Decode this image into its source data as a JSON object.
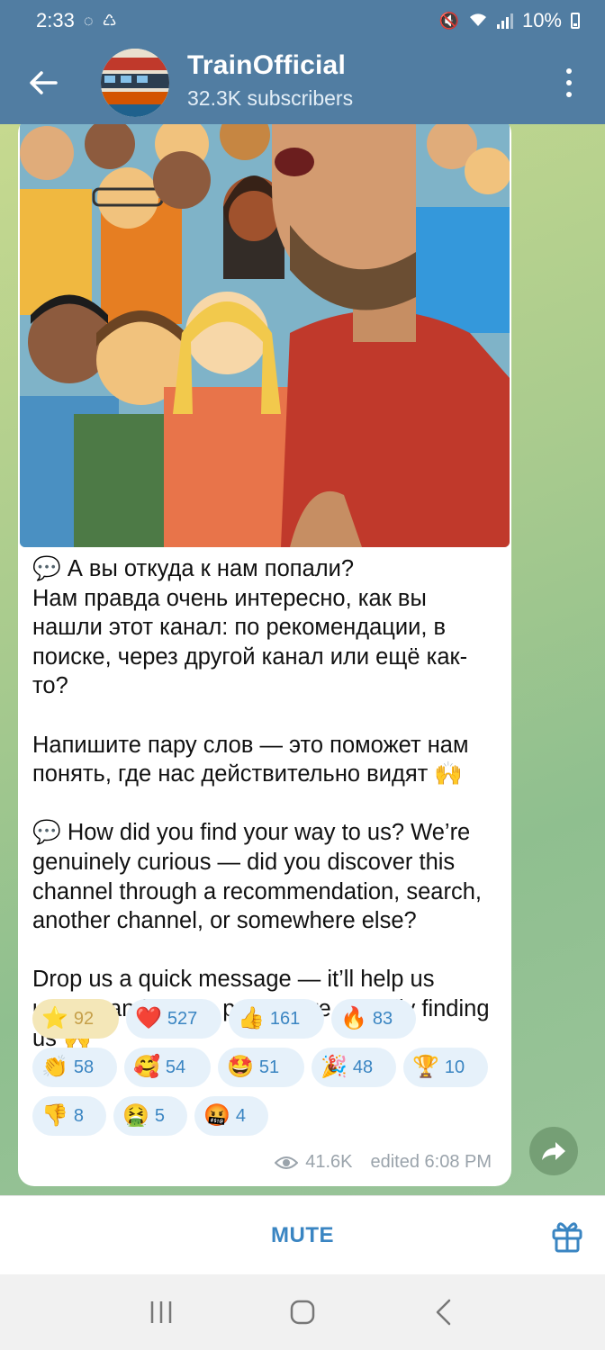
{
  "status_bar": {
    "time": "2:33",
    "battery": "10%"
  },
  "header": {
    "title": "TrainOfficial",
    "subtitle": "32.3K subscribers"
  },
  "message": {
    "text_ru_1": "💬 А вы откуда к нам попали?\nНам правда очень интересно, как вы нашли этот канал: по рекомендации, в поиске, через другой канал или ещё как-то?",
    "text_ru_2": "Напишите пару слов — это поможет нам понять, где нас действительно видят 🙌",
    "text_en_1": "💬 How did you find your way to us? We’re genuinely curious — did you discover this channel through a recommendation, search, another channel, or somewhere else?",
    "text_en_2": "Drop us a quick message — it’ll help us understand where people are actually finding us 🙌",
    "views": "41.6K",
    "edited": "edited 6:08 PM"
  },
  "reactions": [
    {
      "emoji": "⭐",
      "count": "92",
      "active": true
    },
    {
      "emoji": "❤️",
      "count": "527"
    },
    {
      "emoji": "👍",
      "count": "161"
    },
    {
      "emoji": "🔥",
      "count": "83"
    },
    {
      "emoji": "👏",
      "count": "58"
    },
    {
      "emoji": "🥰",
      "count": "54"
    },
    {
      "emoji": "🤩",
      "count": "51"
    },
    {
      "emoji": "🎉",
      "count": "48"
    },
    {
      "emoji": "🏆",
      "count": "10"
    },
    {
      "emoji": "👎",
      "count": "8"
    },
    {
      "emoji": "🤮",
      "count": "5"
    },
    {
      "emoji": "🤬",
      "count": "4"
    }
  ],
  "bottom": {
    "mute_label": "MUTE"
  },
  "colors": {
    "header": "#517da2",
    "accent": "#3a85c2",
    "star_reaction_bg": "#f4e7b8"
  },
  "icons": [
    "back-arrow-icon",
    "more-vertical-icon",
    "eye-icon",
    "share-icon",
    "gift-icon",
    "recent-apps-icon",
    "home-icon",
    "back-nav-icon"
  ]
}
